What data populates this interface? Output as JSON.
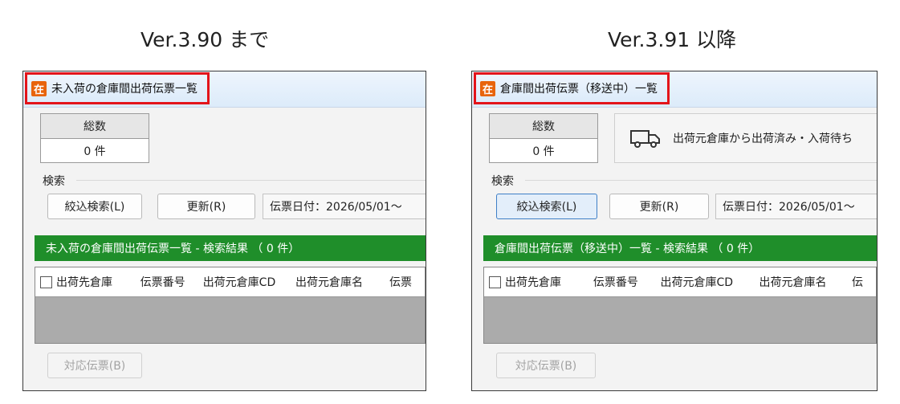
{
  "left": {
    "version_label": "Ver.3.90 まで",
    "title": "未入荷の倉庫間出荷伝票一覧",
    "total_header": "総数",
    "total_value": "0 件",
    "search_label": "検索",
    "filter_button": "絞込検索(L)",
    "refresh_button": "更新(R)",
    "date_filter": "伝票日付：2026/05/01～",
    "results_title": "未入荷の倉庫間出荷伝票一覧 - 検索結果 （ 0 件）",
    "columns": [
      "出荷先倉庫",
      "伝票番号",
      "出荷元倉庫CD",
      "出荷元倉庫名",
      "伝票"
    ],
    "bottom_button": "対応伝票(B)"
  },
  "right": {
    "version_label": "Ver.3.91 以降",
    "title": "倉庫間出荷伝票（移送中）一覧",
    "total_header": "総数",
    "total_value": "0 件",
    "status_text": "出荷元倉庫から出荷済み・入荷待ち",
    "search_label": "検索",
    "filter_button": "絞込検索(L)",
    "refresh_button": "更新(R)",
    "date_filter": "伝票日付：2026/05/01～",
    "results_title": "倉庫間出荷伝票（移送中）一覧 - 検索結果 （ 0 件）",
    "columns": [
      "出荷先倉庫",
      "伝票番号",
      "出荷元倉庫CD",
      "出荷元倉庫名",
      "伝"
    ],
    "bottom_button": "対応伝票(B)"
  },
  "app_icon_glyph": "在",
  "icons": {
    "app": "zaiko-app-icon",
    "truck": "truck-icon"
  },
  "colors": {
    "highlight": "#e3141a",
    "results_bar": "#1f8e2a",
    "app_icon": "#e8640c"
  }
}
